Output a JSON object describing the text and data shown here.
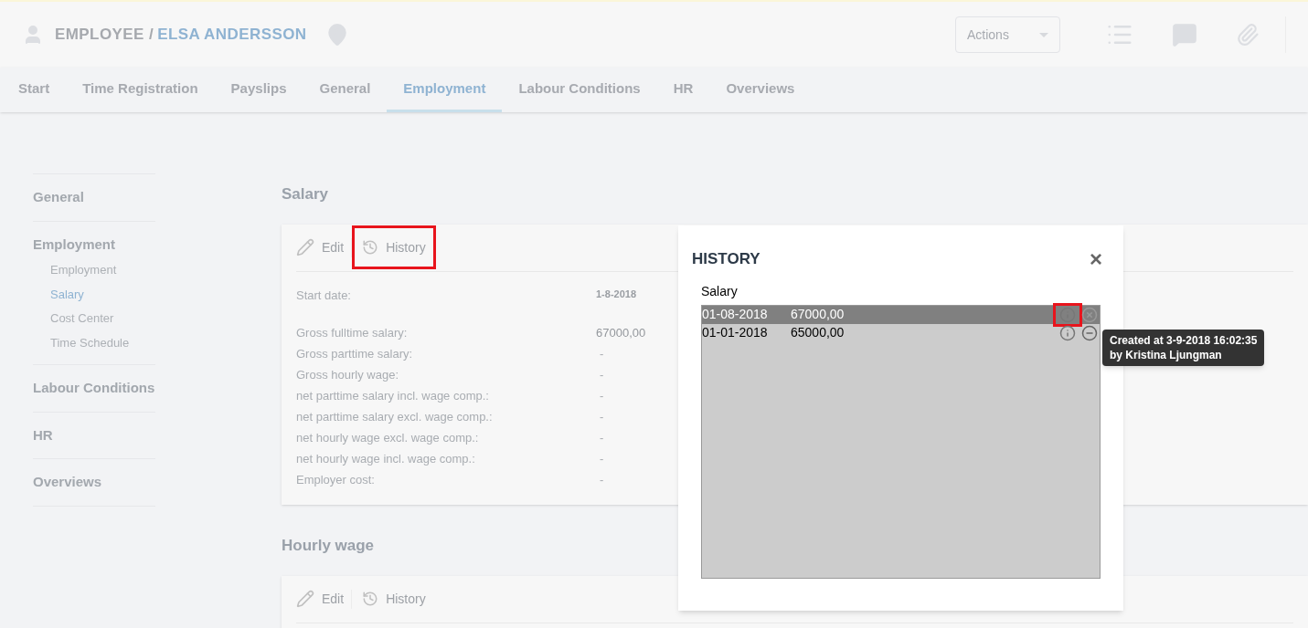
{
  "header": {
    "title_prefix": "EMPLOYEE /",
    "title_name": "ELSA ANDERSSON",
    "actions_label": "Actions"
  },
  "tabs": [
    {
      "label": "Start",
      "selected": false
    },
    {
      "label": "Time Registration",
      "selected": false
    },
    {
      "label": "Payslips",
      "selected": false
    },
    {
      "label": "General",
      "selected": false
    },
    {
      "label": "Employment",
      "selected": true
    },
    {
      "label": "Labour Conditions",
      "selected": false
    },
    {
      "label": "HR",
      "selected": false
    },
    {
      "label": "Overviews",
      "selected": false
    }
  ],
  "sidebar": [
    {
      "label": "General"
    },
    {
      "label": "Employment",
      "children": [
        {
          "label": "Employment",
          "selected": false
        },
        {
          "label": "Salary",
          "selected": true
        },
        {
          "label": "Cost Center",
          "selected": false
        },
        {
          "label": "Time Schedule",
          "selected": false
        }
      ]
    },
    {
      "label": "Labour Conditions"
    },
    {
      "label": "HR"
    },
    {
      "label": "Overviews"
    }
  ],
  "sections": [
    {
      "title": "Salary",
      "edit_label": "Edit",
      "history_label": "History",
      "history_highlighted": true,
      "start_label": "Start date:",
      "start_value": "1-8-2018",
      "fields": [
        {
          "label": "Gross fulltime salary:",
          "value": "67000,00"
        },
        {
          "label": "Gross parttime salary:",
          "value": "-"
        },
        {
          "label": "Gross hourly wage:",
          "value": "-"
        },
        {
          "label": "net parttime salary incl. wage comp.:",
          "value": "-"
        },
        {
          "label": "net parttime salary excl. wage comp.:",
          "value": "-"
        },
        {
          "label": "net hourly wage excl. wage comp.:",
          "value": "-"
        },
        {
          "label": "net hourly wage incl. wage comp.:",
          "value": "-"
        },
        {
          "label": "Employer cost:",
          "value": "-"
        }
      ]
    },
    {
      "title": "Hourly wage",
      "edit_label": "Edit",
      "history_label": "History",
      "history_highlighted": false
    }
  ],
  "modal": {
    "title": "HISTORY",
    "close": "×",
    "list_title": "Salary",
    "rows": [
      {
        "date": "01-08-2018",
        "amount": "67000,00",
        "selected": true,
        "info_highlighted": true
      },
      {
        "date": "01-01-2018",
        "amount": "65000,00",
        "selected": false,
        "info_highlighted": false
      }
    ],
    "tooltip": [
      "Created at 3-9-2018 16:02:35",
      "by Kristina Ljungman"
    ]
  }
}
